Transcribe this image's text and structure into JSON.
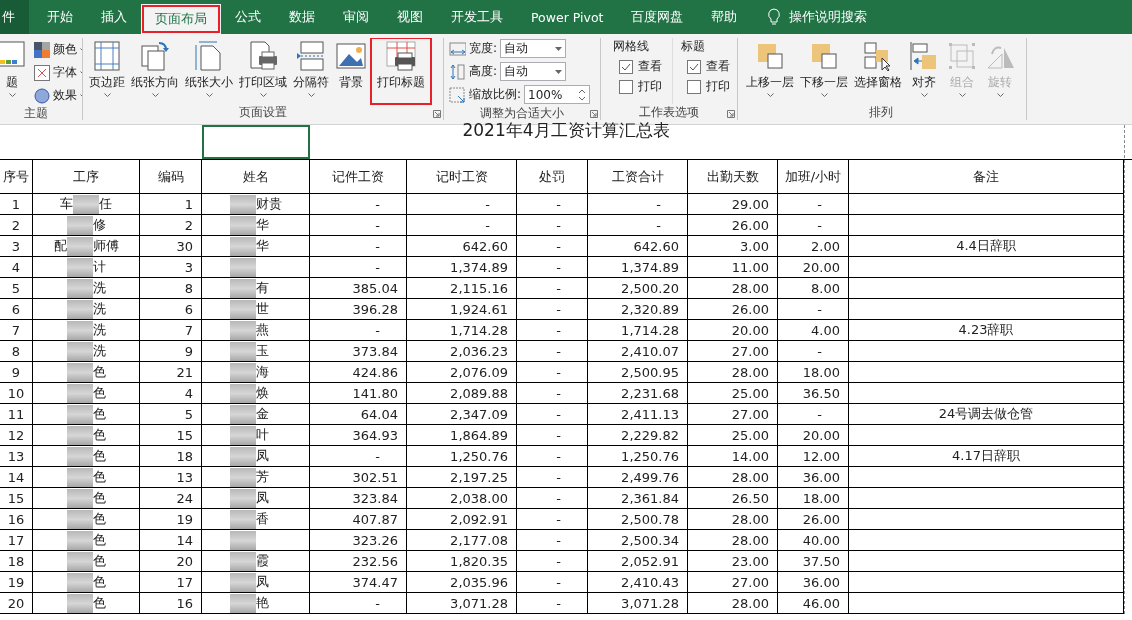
{
  "tabs": [
    {
      "label": "件",
      "kind": "file",
      "selected": false,
      "highlighted": false
    },
    {
      "label": "开始",
      "kind": "tab",
      "selected": false,
      "highlighted": false
    },
    {
      "label": "插入",
      "kind": "tab",
      "selected": false,
      "highlighted": false
    },
    {
      "label": "页面布局",
      "kind": "tab",
      "selected": true,
      "highlighted": true
    },
    {
      "label": "公式",
      "kind": "tab",
      "selected": false,
      "highlighted": false
    },
    {
      "label": "数据",
      "kind": "tab",
      "selected": false,
      "highlighted": false
    },
    {
      "label": "审阅",
      "kind": "tab",
      "selected": false,
      "highlighted": false
    },
    {
      "label": "视图",
      "kind": "tab",
      "selected": false,
      "highlighted": false
    },
    {
      "label": "开发工具",
      "kind": "tab",
      "selected": false,
      "highlighted": false
    },
    {
      "label": "Power Pivot",
      "kind": "tab",
      "selected": false,
      "highlighted": false
    },
    {
      "label": "百度网盘",
      "kind": "tab",
      "selected": false,
      "highlighted": false
    },
    {
      "label": "帮助",
      "kind": "tab",
      "selected": false,
      "highlighted": false
    }
  ],
  "tell_me": {
    "label": "操作说明搜索"
  },
  "ribbon": {
    "theme": {
      "label": "主题",
      "big_button": {
        "label": "题"
      },
      "items": [
        {
          "label": "颜色"
        },
        {
          "label": "字体"
        },
        {
          "label": "效果"
        }
      ]
    },
    "page_setup": {
      "label": "页面设置",
      "buttons": [
        {
          "label": "页边距",
          "dropdown": true,
          "highlighted": false
        },
        {
          "label": "纸张方向",
          "dropdown": true,
          "highlighted": false
        },
        {
          "label": "纸张大小",
          "dropdown": true,
          "highlighted": false
        },
        {
          "label": "打印区域",
          "dropdown": true,
          "highlighted": false
        },
        {
          "label": "分隔符",
          "dropdown": true,
          "highlighted": false
        },
        {
          "label": "背景",
          "dropdown": false,
          "highlighted": false
        },
        {
          "label": "打印标题",
          "dropdown": false,
          "highlighted": true
        }
      ]
    },
    "scale_to_fit": {
      "label": "调整为合适大小",
      "fields": [
        {
          "label": "宽度:",
          "value": "自动",
          "kind": "dropdown"
        },
        {
          "label": "高度:",
          "value": "自动",
          "kind": "dropdown"
        },
        {
          "label": "缩放比例:",
          "value": "100%",
          "kind": "spinner"
        }
      ]
    },
    "sheet_options": {
      "label": "工作表选项",
      "columns": [
        {
          "heading": "网格线",
          "options": [
            {
              "label": "查看",
              "checked": true
            },
            {
              "label": "打印",
              "checked": false
            }
          ]
        },
        {
          "heading": "标题",
          "options": [
            {
              "label": "查看",
              "checked": true
            },
            {
              "label": "打印",
              "checked": false
            }
          ]
        }
      ]
    },
    "arrange": {
      "label": "排列",
      "buttons": [
        {
          "label": "上移一层",
          "dropdown": true,
          "disabled": false
        },
        {
          "label": "下移一层",
          "dropdown": true,
          "disabled": false
        },
        {
          "label": "选择窗格",
          "dropdown": false,
          "disabled": false
        },
        {
          "label": "对齐",
          "dropdown": true,
          "disabled": false
        },
        {
          "label": "组合",
          "dropdown": true,
          "disabled": true
        },
        {
          "label": "旋转",
          "dropdown": true,
          "disabled": true
        }
      ]
    }
  },
  "sheet": {
    "title": "2021年4月工资计算汇总表",
    "columns": [
      "序号",
      "工序",
      "编码",
      "姓名",
      "记件工资",
      "记时工资",
      "处罚",
      "工资合计",
      "出勤天数",
      "加班/小时",
      "备注"
    ],
    "rows": [
      {
        "seq": "1",
        "process_lead": "车",
        "process": "任",
        "code": "1",
        "name": "财贵",
        "piece": "-",
        "time": "-",
        "penalty": "-",
        "total": "-",
        "days": "29.00",
        "overtime": "-"
      },
      {
        "seq": "2",
        "process": "修",
        "code": "2",
        "name": "华",
        "piece": "-",
        "time": "-",
        "penalty": "-",
        "total": "-",
        "days": "26.00",
        "overtime": "-"
      },
      {
        "seq": "3",
        "process_lead": "配",
        "process": "师傅",
        "code": "30",
        "name": "华",
        "piece": "-",
        "time": "642.60",
        "penalty": "-",
        "total": "642.60",
        "days": "3.00",
        "overtime": "2.00",
        "note": "4.4日辞职"
      },
      {
        "seq": "4",
        "process": "计",
        "code": "3",
        "piece": "-",
        "time": "1,374.89",
        "penalty": "-",
        "total": "1,374.89",
        "days": "11.00",
        "overtime": "20.00"
      },
      {
        "seq": "5",
        "process": "洗",
        "code": "8",
        "name": "有",
        "piece": "385.04",
        "time": "2,115.16",
        "penalty": "-",
        "total": "2,500.20",
        "days": "28.00",
        "overtime": "8.00"
      },
      {
        "seq": "6",
        "process": "洗",
        "code": "6",
        "name": "世",
        "piece": "396.28",
        "time": "1,924.61",
        "penalty": "-",
        "total": "2,320.89",
        "days": "26.00",
        "overtime": "-"
      },
      {
        "seq": "7",
        "process": "洗",
        "code": "7",
        "name": "燕",
        "piece": "-",
        "time": "1,714.28",
        "penalty": "-",
        "total": "1,714.28",
        "days": "20.00",
        "overtime": "4.00",
        "note": "4.23辞职"
      },
      {
        "seq": "8",
        "process": "洗",
        "code": "9",
        "name": "玉",
        "piece": "373.84",
        "time": "2,036.23",
        "penalty": "-",
        "total": "2,410.07",
        "days": "27.00",
        "overtime": "-"
      },
      {
        "seq": "9",
        "process": "色",
        "code": "21",
        "name": "海",
        "piece": "424.86",
        "time": "2,076.09",
        "penalty": "-",
        "total": "2,500.95",
        "days": "28.00",
        "overtime": "18.00"
      },
      {
        "seq": "10",
        "process": "色",
        "code": "4",
        "name": "焕",
        "piece": "141.80",
        "time": "2,089.88",
        "penalty": "-",
        "total": "2,231.68",
        "days": "25.00",
        "overtime": "36.50"
      },
      {
        "seq": "11",
        "process": "色",
        "code": "5",
        "name": "金",
        "piece": "64.04",
        "time": "2,347.09",
        "penalty": "-",
        "total": "2,411.13",
        "days": "27.00",
        "overtime": "-",
        "note": "24号调去做仓管"
      },
      {
        "seq": "12",
        "process": "色",
        "code": "15",
        "name": "叶",
        "piece": "364.93",
        "time": "1,864.89",
        "penalty": "-",
        "total": "2,229.82",
        "days": "25.00",
        "overtime": "20.00"
      },
      {
        "seq": "13",
        "process": "色",
        "code": "18",
        "name": "凤",
        "piece": "-",
        "time": "1,250.76",
        "penalty": "-",
        "total": "1,250.76",
        "days": "14.00",
        "overtime": "12.00",
        "note": "4.17日辞职"
      },
      {
        "seq": "14",
        "process": "色",
        "code": "13",
        "name": "芳",
        "piece": "302.51",
        "time": "2,197.25",
        "penalty": "-",
        "total": "2,499.76",
        "days": "28.00",
        "overtime": "36.00"
      },
      {
        "seq": "15",
        "process": "色",
        "code": "24",
        "name": "凤",
        "piece": "323.84",
        "time": "2,038.00",
        "penalty": "-",
        "total": "2,361.84",
        "days": "26.50",
        "overtime": "18.00"
      },
      {
        "seq": "16",
        "process": "色",
        "code": "19",
        "name": "香",
        "piece": "407.87",
        "time": "2,092.91",
        "penalty": "-",
        "total": "2,500.78",
        "days": "28.00",
        "overtime": "26.00"
      },
      {
        "seq": "17",
        "process": "色",
        "code": "14",
        "piece": "323.26",
        "time": "2,177.08",
        "penalty": "-",
        "total": "2,500.34",
        "days": "28.00",
        "overtime": "40.00"
      },
      {
        "seq": "18",
        "process": "色",
        "code": "20",
        "name": "霞",
        "piece": "232.56",
        "time": "1,820.35",
        "penalty": "-",
        "total": "2,052.91",
        "days": "23.00",
        "overtime": "37.50"
      },
      {
        "seq": "19",
        "process": "色",
        "code": "17",
        "name": "凤",
        "piece": "374.47",
        "time": "2,035.96",
        "penalty": "-",
        "total": "2,410.43",
        "days": "27.00",
        "overtime": "36.00"
      },
      {
        "seq": "20",
        "process": "色",
        "code": "16",
        "name": "艳",
        "piece": "-",
        "time": "3,071.28",
        "penalty": "-",
        "total": "3,071.28",
        "days": "28.00",
        "overtime": "46.00"
      }
    ]
  }
}
